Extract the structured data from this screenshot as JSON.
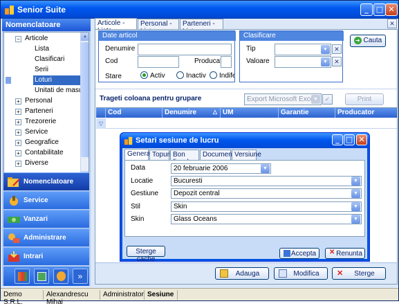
{
  "app": {
    "title": "Senior Suite"
  },
  "sidebar": {
    "header": "Nomenclatoare",
    "tree": [
      {
        "label": "Articole",
        "level": 0,
        "expanded": true
      },
      {
        "label": "Lista",
        "level": 1
      },
      {
        "label": "Clasificari",
        "level": 1
      },
      {
        "label": "Serii",
        "level": 1
      },
      {
        "label": "Loturi",
        "level": 1,
        "selected": true
      },
      {
        "label": "Unitati de masura",
        "level": 1
      },
      {
        "label": "Personal",
        "level": 0
      },
      {
        "label": "Parteneri",
        "level": 0
      },
      {
        "label": "Trezorerie",
        "level": 0
      },
      {
        "label": "Service",
        "level": 0
      },
      {
        "label": "Geografice",
        "level": 0
      },
      {
        "label": "Contabilitate",
        "level": 0
      },
      {
        "label": "Diverse",
        "level": 0
      }
    ],
    "modules": [
      "Nomenclatoare",
      "Service",
      "Vanzari",
      "Administrare",
      "Intrari"
    ],
    "active_module": "Nomenclatoare"
  },
  "tabs": [
    "Articole - Lista",
    "Personal - Lista",
    "Parteneri - Lista"
  ],
  "filters": {
    "group_title": "Date articol",
    "denumire_label": "Denumire",
    "cod_label": "Cod",
    "producator_label": "Producator",
    "stare_label": "Stare",
    "stare_options": [
      "Activ",
      "Inactiv",
      "Indiferent"
    ],
    "stare_selected": "Activ",
    "clasificare_title": "Clasificare",
    "tip_label": "Tip",
    "valoare_label": "Valoare",
    "search_button": "Cauta"
  },
  "grid": {
    "group_hint": "Trageti coloana pentru grupare",
    "export_option": "Export Microsoft Excel",
    "print_button": "Print",
    "columns": [
      "Cod",
      "Denumire",
      "UM",
      "Garantie",
      "Producator"
    ]
  },
  "actions": {
    "add": "Adauga",
    "edit": "Modifica",
    "delete": "Sterge"
  },
  "dialog": {
    "title": "Setari sesiune de lucru",
    "tabs": [
      "General",
      "Topuri",
      "Bon fiscal",
      "Documente",
      "Versiune"
    ],
    "fields": [
      {
        "label": "Data",
        "value": "20 februarie 2006"
      },
      {
        "label": "Locatie",
        "value": "Bucuresti"
      },
      {
        "label": "Gestiune",
        "value": "Depozit central"
      },
      {
        "label": "Stil",
        "value": "Skin"
      },
      {
        "label": "Skin",
        "value": "Glass Oceans"
      }
    ],
    "clear_cache": "Sterge cache",
    "accept": "Accepta",
    "cancel": "Renunta"
  },
  "status": [
    "Demo S.R.L.",
    "Alexandrescu Mihai",
    "Administrator",
    "Sesiune"
  ],
  "colors": {
    "accent": "#0054e3",
    "header": "#2d62d0",
    "selection": "#316ac5"
  }
}
